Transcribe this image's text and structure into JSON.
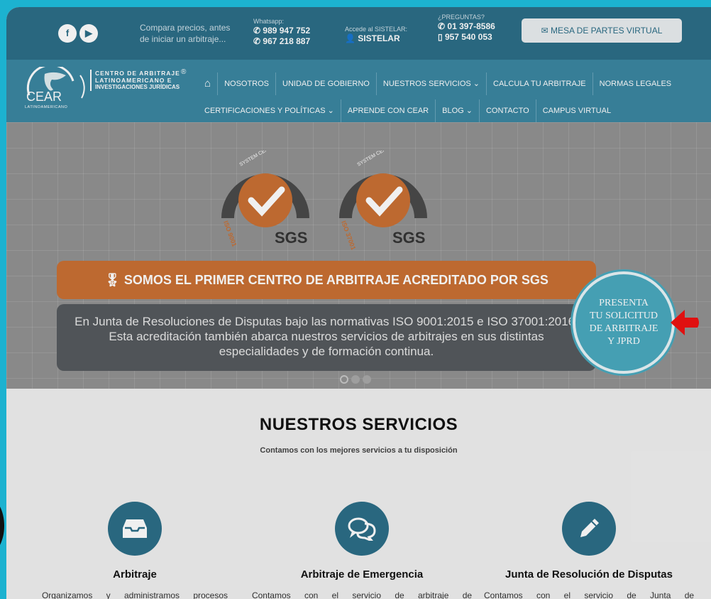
{
  "topbar": {
    "compare_line1": "Compara precios, antes",
    "compare_line2": "de iniciar un arbitraje...",
    "whatsapp_label": "Whatsapp:",
    "whatsapp_1": "989 947 752",
    "whatsapp_2": "967 218 887",
    "sistelar_label": "Accede al SISTELAR:",
    "sistelar": "SISTELAR",
    "preguntas_label": "¿PREGUNTAS?",
    "phone_1": "01 397-8586",
    "phone_2": "957 540 053",
    "mesa_button": "MESA DE PARTES VIRTUAL"
  },
  "logo": {
    "name": "CEAR",
    "tagline": "LATINOAMERICANO",
    "line1": "CENTRO DE ARBITRAJE",
    "line2": "LATINOAMERICANO E",
    "line3": "INVESTIGACIONES JURÍDICAS",
    "reg": "®"
  },
  "nav": {
    "row1": [
      "NOSOTROS",
      "UNIDAD DE GOBIERNO",
      "NUESTROS SERVICIOS ⌄",
      "CALCULA TU ARBITRAJE",
      "NORMAS LEGALES"
    ],
    "row2": [
      "CERTIFICACIONES Y POLÍTICAS ⌄",
      "APRENDE CON CEAR",
      "BLOG ⌄",
      "CONTACTO",
      "CAMPUS VIRTUAL"
    ]
  },
  "hero": {
    "cert_top": "SYSTEM CERTIFICATION",
    "iso_1": "ISO 9001",
    "iso_2": "ISO 37001",
    "sgs": "SGS",
    "banner": "SOMOS EL PRIMER CENTRO DE ARBITRAJE ACREDITADO POR SGS",
    "description": "En Junta de Resoluciones de Disputas bajo las normativas ISO 9001:2015 e ISO 37001:2016. Esta acreditación también abarca nuestros servicios de arbitrajes en sus distintas especialidades y de formación continua.",
    "cta_line1": "PRESENTA",
    "cta_line2": "TU SOLICITUD",
    "cta_line3": "DE ARBITRAJE",
    "cta_line4": "Y JPRD"
  },
  "services": {
    "title": "NUESTROS SERVICIOS",
    "subtitle": "Contamos con los mejores servicios a tu disposición",
    "items": [
      {
        "name": "Arbitraje",
        "text": "Organizamos y administramos procesos",
        "icon": "inbox-icon"
      },
      {
        "name": "Arbitraje de Emergencia",
        "text": "Contamos con el servicio de arbitraje de",
        "icon": "chat-icon"
      },
      {
        "name": "Junta de Resolución de Disputas",
        "text": "Contamos con el servicio de Junta de",
        "icon": "pencil-icon"
      }
    ]
  },
  "colors": {
    "primary": "#2c6e87",
    "nav": "#3b86a1",
    "accent": "#c97034",
    "background": "#1cb2d0"
  }
}
